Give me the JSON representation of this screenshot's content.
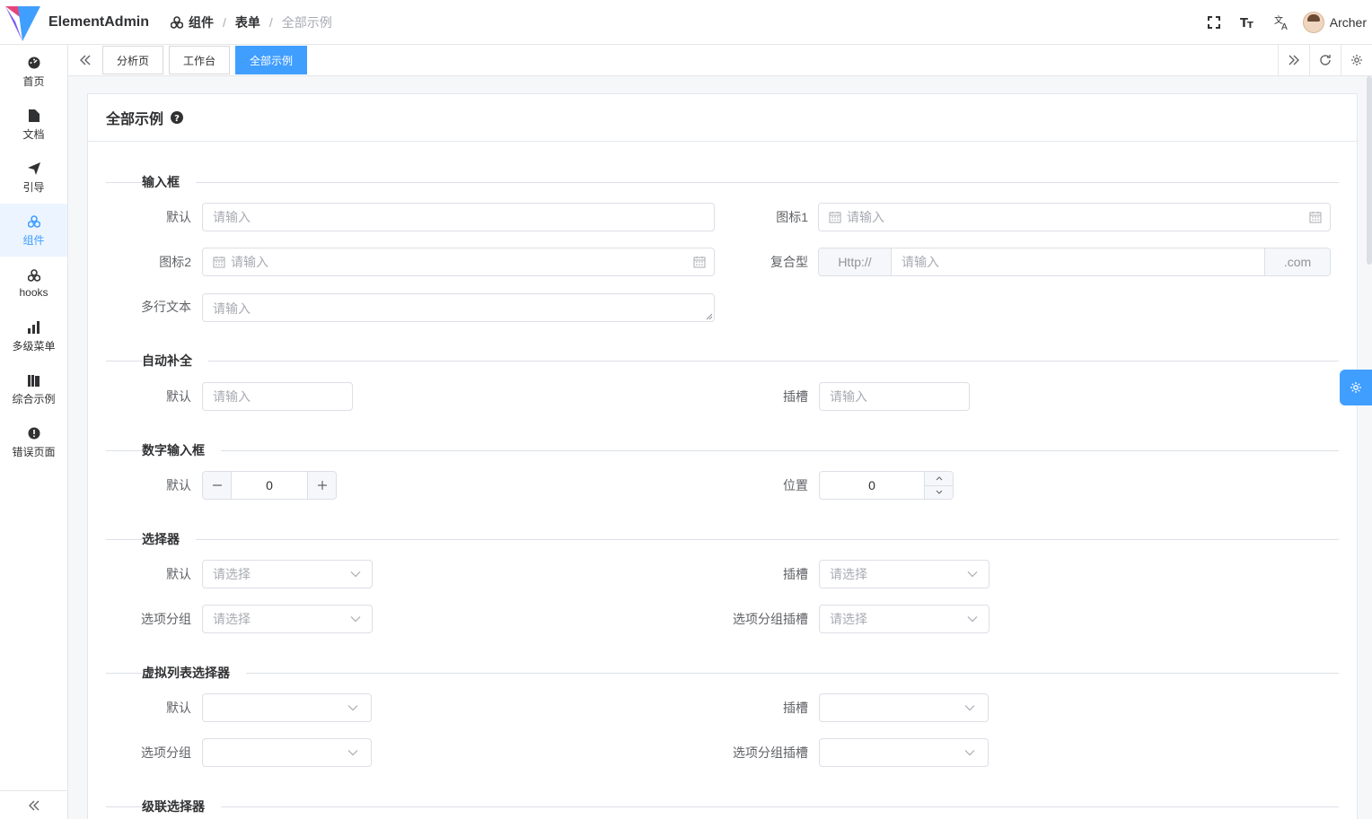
{
  "header": {
    "app_title": "ElementAdmin",
    "breadcrumb": [
      "组件",
      "表单",
      "全部示例"
    ],
    "user_name": "Archer",
    "icons": [
      "fullscreen-icon",
      "font-size-icon",
      "translate-icon"
    ]
  },
  "sidebar": {
    "items": [
      {
        "label": "首页",
        "icon": "dashboard-icon"
      },
      {
        "label": "文档",
        "icon": "document-icon"
      },
      {
        "label": "引导",
        "icon": "send-icon"
      },
      {
        "label": "组件",
        "icon": "component-icon",
        "active": true
      },
      {
        "label": "hooks",
        "icon": "hooks-icon"
      },
      {
        "label": "多级菜单",
        "icon": "bar-chart-icon"
      },
      {
        "label": "综合示例",
        "icon": "library-icon"
      },
      {
        "label": "错误页面",
        "icon": "error-icon"
      }
    ]
  },
  "tags": [
    {
      "label": "分析页"
    },
    {
      "label": "工作台"
    },
    {
      "label": "全部示例",
      "active": true
    }
  ],
  "card": {
    "title": "全部示例"
  },
  "form": {
    "sec_input": "输入框",
    "lbl_default": "默认",
    "lbl_icon1": "图标1",
    "lbl_icon2": "图标2",
    "lbl_composite": "复合型",
    "lbl_textarea": "多行文本",
    "ph_input": "请输入",
    "composite_prefix": "Http://",
    "composite_suffix": ".com",
    "sec_autocomplete": "自动补全",
    "lbl_slot": "插槽",
    "sec_number": "数字输入框",
    "lbl_position": "位置",
    "number_value_1": "0",
    "number_value_2": "0",
    "sec_select": "选择器",
    "lbl_option_group": "选项分组",
    "lbl_option_group_slot": "选项分组插槽",
    "ph_select": "请选择",
    "sec_virtual": "虚拟列表选择器",
    "sec_cascader": "级联选择器"
  },
  "colors": {
    "primary": "#409eff",
    "active_bg": "#ecf5ff",
    "border": "#dcdfe6"
  }
}
